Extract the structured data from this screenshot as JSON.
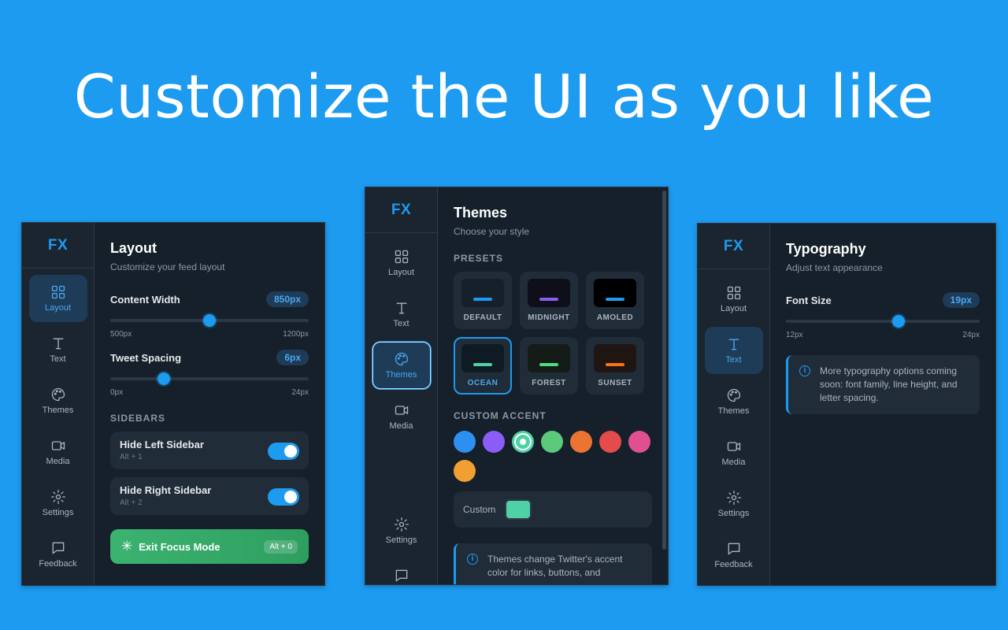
{
  "headline": "Customize the UI as you like",
  "brand": {
    "logo": "FX",
    "accent": "#1d9bf0"
  },
  "nav": [
    {
      "label": "Layout",
      "icon": "layout-grid-icon"
    },
    {
      "label": "Text",
      "icon": "text-icon"
    },
    {
      "label": "Themes",
      "icon": "palette-icon"
    },
    {
      "label": "Media",
      "icon": "video-icon"
    },
    {
      "label": "Settings",
      "icon": "gear-icon"
    },
    {
      "label": "Feedback",
      "icon": "chat-bubble-icon"
    }
  ],
  "layout_panel": {
    "title": "Layout",
    "subtitle": "Customize your feed layout",
    "content_width": {
      "label": "Content Width",
      "value": "850px",
      "min": "500px",
      "max": "1200px",
      "fraction": 0.5
    },
    "tweet_spacing": {
      "label": "Tweet Spacing",
      "value": "6px",
      "min": "0px",
      "max": "24px",
      "fraction": 0.27
    },
    "sidebars_heading": "SIDEBARS",
    "hide_left": {
      "title": "Hide Left Sidebar",
      "shortcut": "Alt + 1",
      "on": true
    },
    "hide_right": {
      "title": "Hide Right Sidebar",
      "shortcut": "Alt + 2",
      "on": true
    },
    "exit_button": {
      "label": "Exit Focus Mode",
      "shortcut": "Alt + 0",
      "icon": "sparkle-icon"
    }
  },
  "themes_panel": {
    "title": "Themes",
    "subtitle": "Choose your style",
    "presets_heading": "PRESETS",
    "presets": [
      {
        "name": "DEFAULT",
        "bg": "#15202b",
        "accent": "#1d9bf0",
        "selected": false
      },
      {
        "name": "MIDNIGHT",
        "bg": "#0f0f1a",
        "accent": "#8b5cf6",
        "selected": false
      },
      {
        "name": "AMOLED",
        "bg": "#000000",
        "accent": "#1d9bf0",
        "selected": false
      },
      {
        "name": "OCEAN",
        "bg": "#0e1b24",
        "accent": "#4fd1a5",
        "selected": true
      },
      {
        "name": "FOREST",
        "bg": "#151c18",
        "accent": "#4ade80",
        "selected": false
      },
      {
        "name": "SUNSET",
        "bg": "#1f1614",
        "accent": "#f97316",
        "selected": false
      }
    ],
    "custom_accent_heading": "CUSTOM ACCENT",
    "accents": [
      "#2d8ff0",
      "#8b5cf6",
      "#4fd1a5",
      "#5cc97a",
      "#ec7433",
      "#e44b4b",
      "#e0508f",
      "#f0a030"
    ],
    "selected_accent_index": 2,
    "custom_label": "Custom",
    "custom_color": "#4fd1a5",
    "info_text": "Themes change Twitter's accent color for links, buttons, and"
  },
  "typography_panel": {
    "title": "Typography",
    "subtitle": "Adjust text appearance",
    "font_size": {
      "label": "Font Size",
      "value": "19px",
      "min": "12px",
      "max": "24px",
      "fraction": 0.58
    },
    "info_text": "More typography options coming soon: font family, line height, and letter spacing."
  }
}
